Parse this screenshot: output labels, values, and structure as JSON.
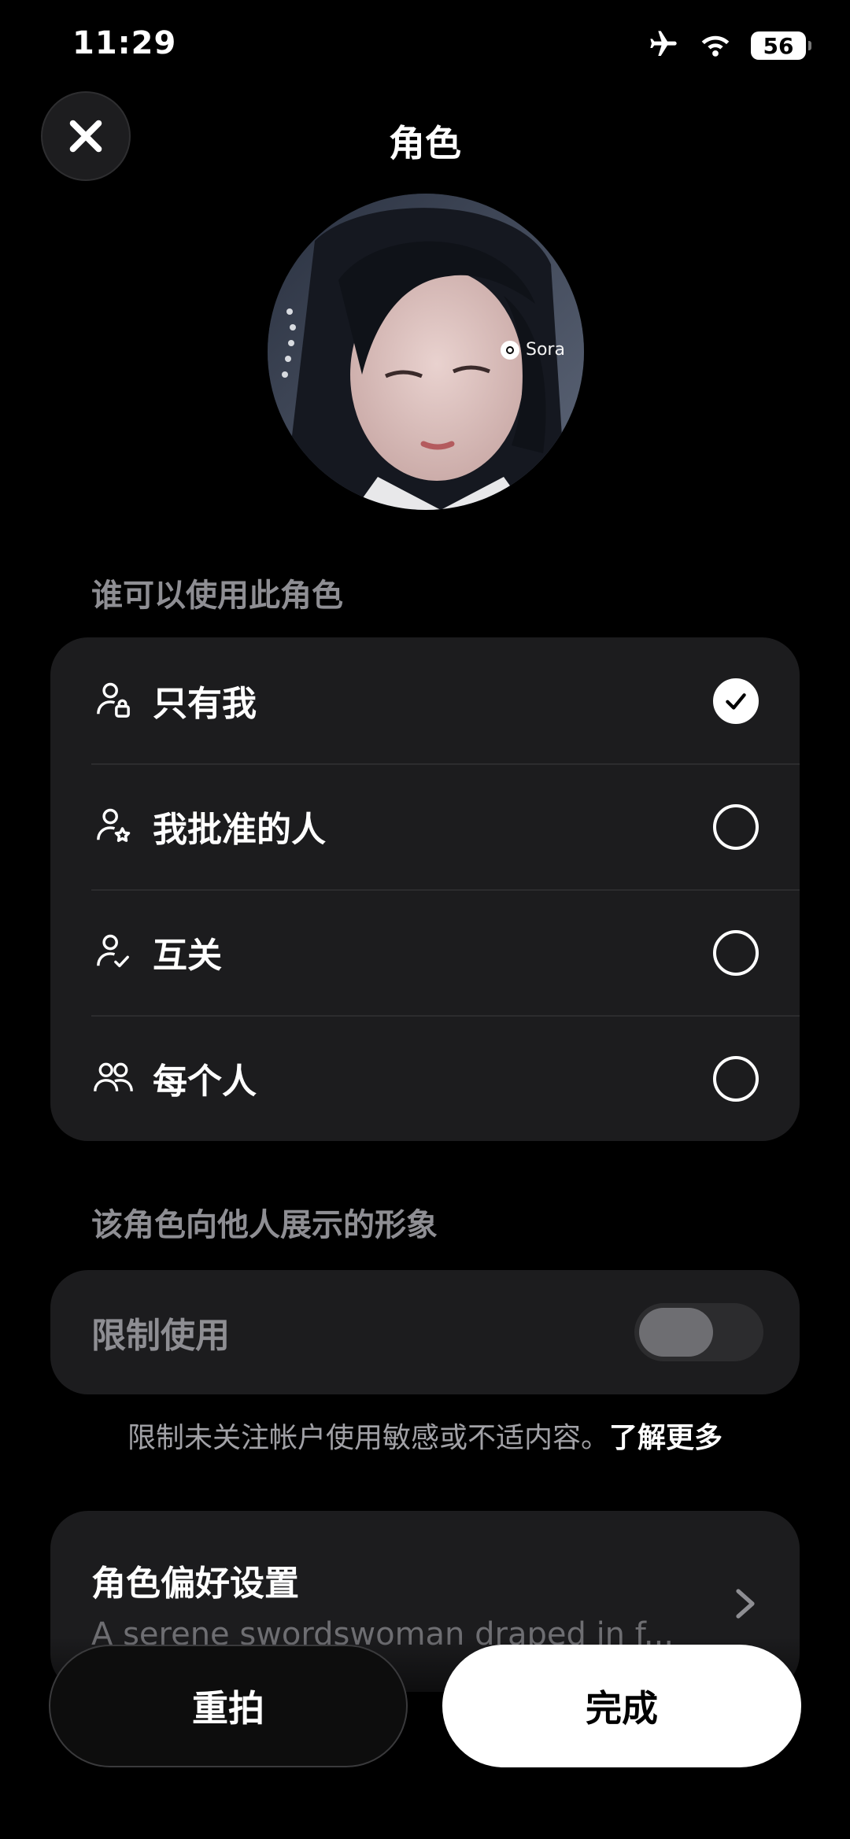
{
  "status_bar": {
    "time": "11:29",
    "battery": "56",
    "icons": [
      "airplane-icon",
      "wifi-icon",
      "battery-icon"
    ]
  },
  "header": {
    "title": "角色",
    "close_icon": "close-icon"
  },
  "avatar": {
    "watermark": "Sora"
  },
  "access": {
    "label": "谁可以使用此角色",
    "selected": 0,
    "options": [
      {
        "label": "只有我",
        "icon": "person-lock-icon"
      },
      {
        "label": "我批准的人",
        "icon": "person-star-icon"
      },
      {
        "label": "互关",
        "icon": "person-check-icon"
      },
      {
        "label": "每个人",
        "icon": "people-icon"
      }
    ]
  },
  "appearance": {
    "label": "该角色向他人展示的形象",
    "restrict_label": "限制使用",
    "restrict_enabled": false,
    "note": "限制未关注帐户使用敏感或不适内容。",
    "note_link": "了解更多"
  },
  "preferences": {
    "title": "角色偏好设置",
    "description": "A serene swordswoman draped in f..."
  },
  "actions": {
    "retake": "重拍",
    "done": "完成"
  },
  "colors": {
    "background": "#000000",
    "card": "#1c1c1e",
    "muted_text": "#8e8e93"
  }
}
